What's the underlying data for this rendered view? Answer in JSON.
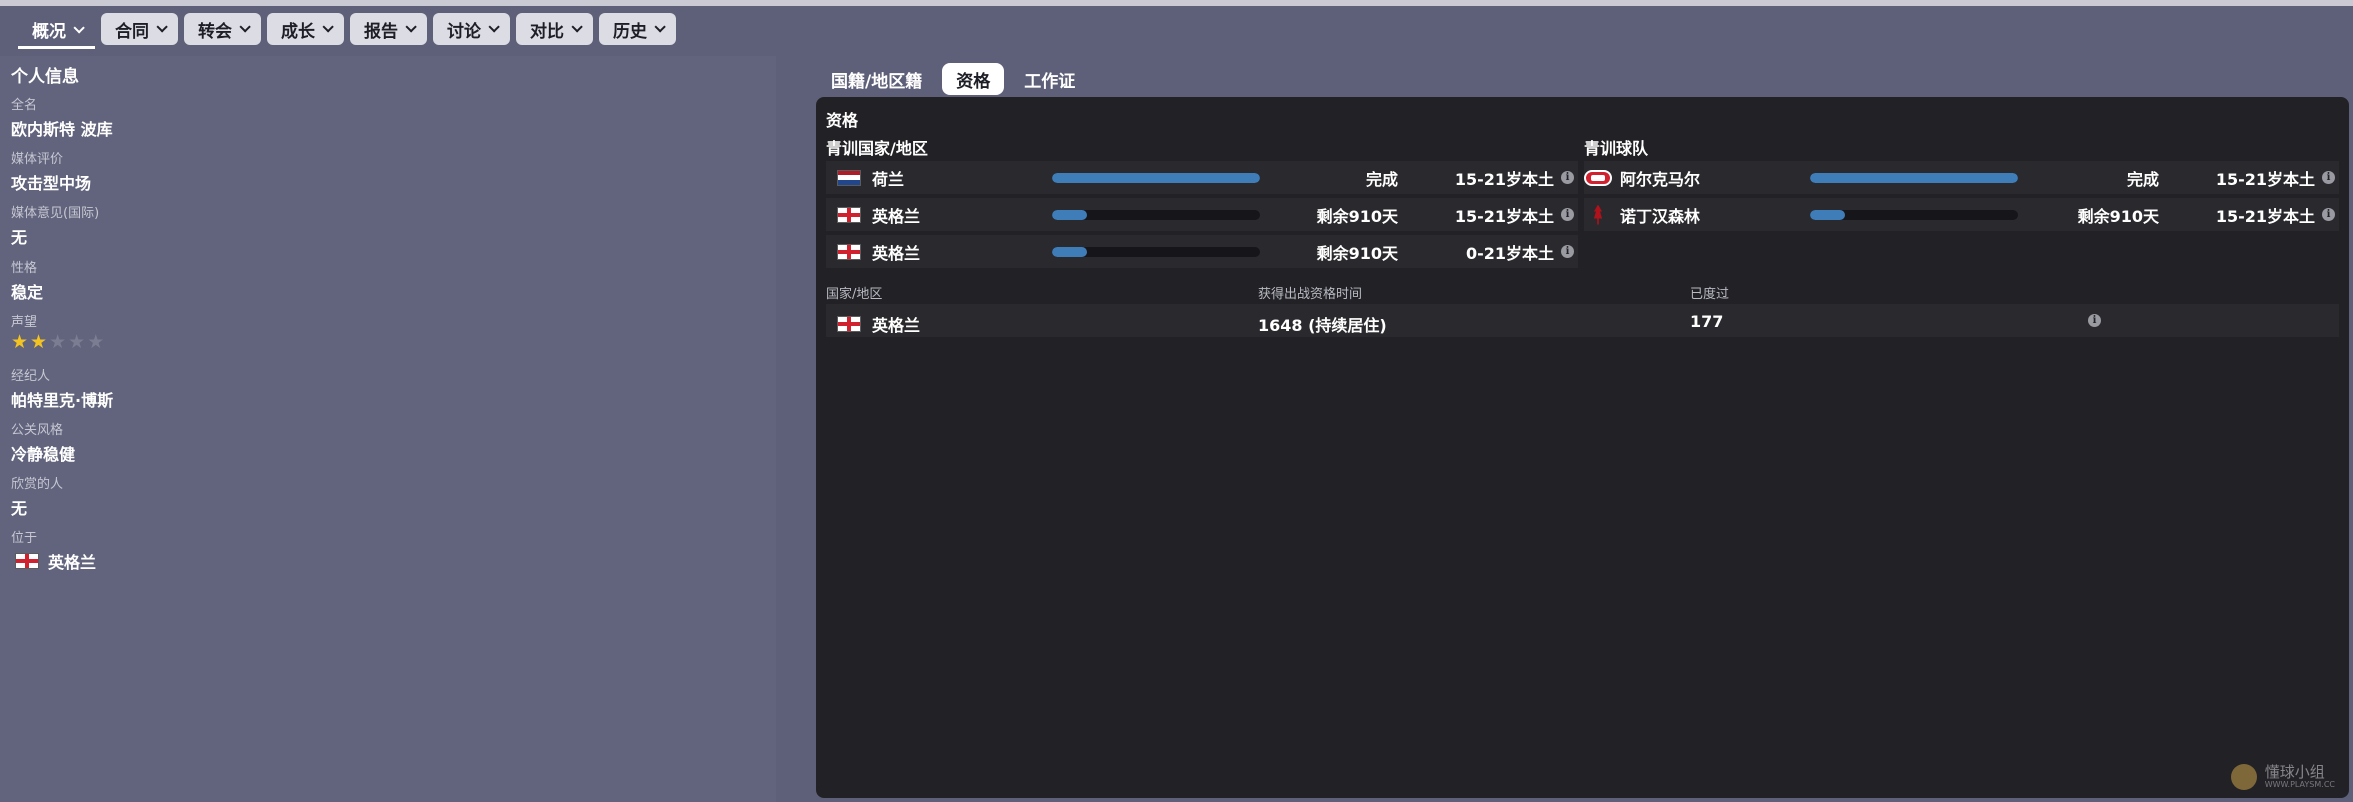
{
  "nav": {
    "items": [
      {
        "label": "概况",
        "active": true
      },
      {
        "label": "合同"
      },
      {
        "label": "转会"
      },
      {
        "label": "成长"
      },
      {
        "label": "报告"
      },
      {
        "label": "讨论"
      },
      {
        "label": "对比"
      },
      {
        "label": "历史"
      }
    ]
  },
  "personal": {
    "title": "个人信息",
    "full_name_label": "全名",
    "full_name": "欧内斯特 波库",
    "media_rating_label": "媒体评价",
    "media_rating": "攻击型中场",
    "media_opinion_label": "媒体意见(国际)",
    "media_opinion": "无",
    "personality_label": "性格",
    "personality": "稳定",
    "reputation_label": "声望",
    "reputation_stars": 2,
    "reputation_max": 5,
    "agent_label": "经纪人",
    "agent": "帕特里克·博斯",
    "pr_style_label": "公关风格",
    "pr_style": "冷静稳健",
    "favored_label": "欣赏的人",
    "favored": "无",
    "location_label": "位于",
    "location": "英格兰",
    "location_flag": "england-flag"
  },
  "tabs": [
    {
      "label": "国籍/地区籍"
    },
    {
      "label": "资格",
      "active": true
    },
    {
      "label": "工作证"
    }
  ],
  "eligibility": {
    "title": "资格",
    "nation_section": "青训国家/地区",
    "club_section": "青训球队",
    "nation_rows": [
      {
        "flag": "netherlands-flag",
        "name": "荷兰",
        "progress": 1.0,
        "status": "完成",
        "age": "15-21岁本土"
      },
      {
        "flag": "england-flag",
        "name": "英格兰",
        "progress": 0.17,
        "status": "剩余910天",
        "age": "15-21岁本土"
      },
      {
        "flag": "england-flag",
        "name": "英格兰",
        "progress": 0.17,
        "status": "剩余910天",
        "age": "0-21岁本土"
      }
    ],
    "club_rows": [
      {
        "badge": "az-alkmaar-badge",
        "name": "阿尔克马尔",
        "progress": 1.0,
        "status": "完成",
        "age": "15-21岁本土"
      },
      {
        "badge": "nottingham-forest-badge",
        "name": "诺丁汉森林",
        "progress": 0.17,
        "status": "剩余910天",
        "age": "15-21岁本土"
      }
    ],
    "columns": [
      "国家/地区",
      "获得出战资格时间",
      "已度过"
    ],
    "result_row": {
      "flag": "england-flag",
      "nation": "英格兰",
      "time": "1648 (持续居住)",
      "elapsed": "177"
    }
  },
  "watermark": {
    "text": "懂球小组",
    "sub": "WWW.PLAYSM.CC"
  },
  "colors": {
    "accent_bar": "#3f7db8",
    "star_on": "#f3c322",
    "panel_bg": "#222226"
  }
}
